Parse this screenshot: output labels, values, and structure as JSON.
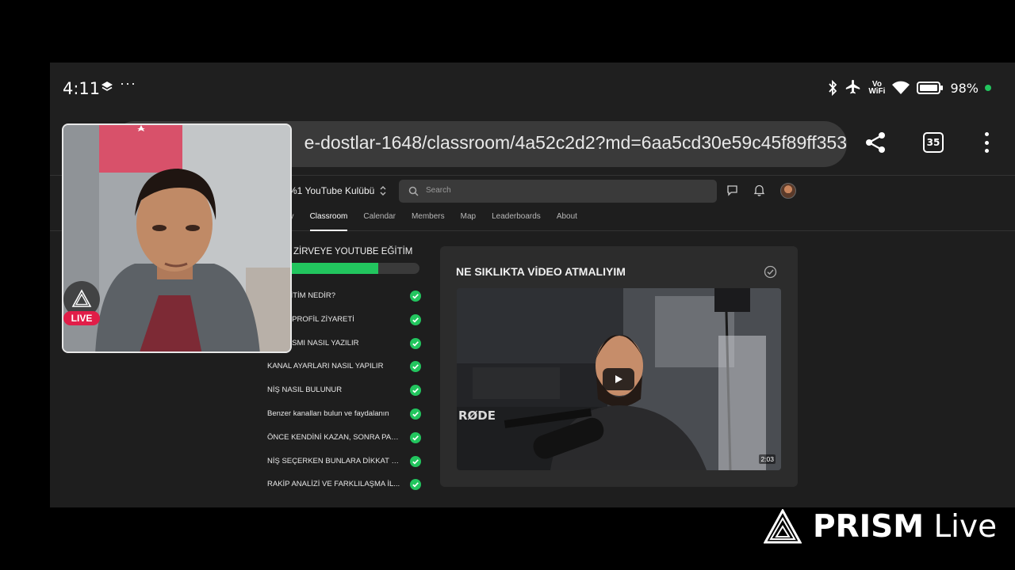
{
  "status_bar": {
    "time": "4:11",
    "more": "···",
    "vowifi_top": "Vo",
    "vowifi_bottom": "WiFi",
    "battery_percent": "98%"
  },
  "browser": {
    "url": "e-dostlar-1648/classroom/4a52c2d2?md=6aa5cd30e59c45f89ff353",
    "tab_count": "35"
  },
  "site": {
    "group_name": "%1 YouTube Kulübü",
    "search_placeholder": "Search",
    "nav_tabs": [
      {
        "label": "nity",
        "active": false
      },
      {
        "label": "Classroom",
        "active": true
      },
      {
        "label": "Calendar",
        "active": false
      },
      {
        "label": "Members",
        "active": false
      },
      {
        "label": "Map",
        "active": false
      },
      {
        "label": "Leaderboards",
        "active": false
      },
      {
        "label": "About",
        "active": false
      }
    ]
  },
  "course": {
    "title": "ZİRVEYE YOUTUBE EĞİTİM",
    "progress_fraction": 0.7,
    "lessons": [
      {
        "label": "BU EĞİTİM NEDİR?"
      },
      {
        "label": "ER VE PROFİL ZİYARETİ"
      },
      {
        "label": "NDA KISMI NASIL YAZILIR"
      },
      {
        "label": "KANAL AYARLARI NASIL YAPILIR"
      },
      {
        "label": "NİŞ NASIL BULUNUR"
      },
      {
        "label": "Benzer kanalları bulun ve faydalanın"
      },
      {
        "label": "ÖNCE KENDİNİ KAZAN, SONRA PAR..."
      },
      {
        "label": "NİŞ SEÇERKEN BUNLARA DİKKAT E..."
      },
      {
        "label": "RAKİP ANALİZİ VE FARKLILAŞMA İL..."
      }
    ]
  },
  "lesson_card": {
    "title": "NE SIKLIKTA VİDEO ATMALIYIM",
    "duration": "2:03",
    "mic_brand": "RØDE"
  },
  "overlay": {
    "live_label": "LIVE",
    "brand_bold": "PRISM",
    "brand_light": "Live"
  },
  "colors": {
    "accent_green": "#22c55e",
    "live_red": "#e11d48"
  }
}
